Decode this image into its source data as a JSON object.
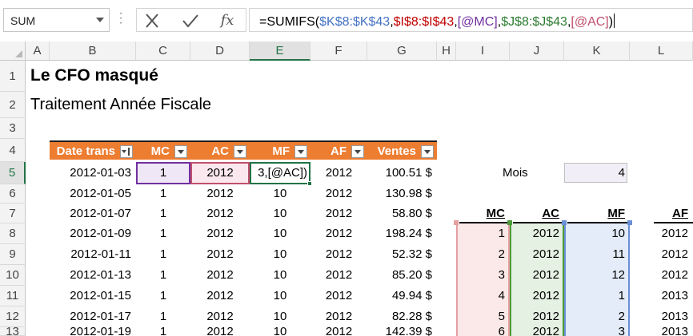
{
  "formula_bar": {
    "name_box": "SUM",
    "fx_label": "fx",
    "formula_parts": [
      {
        "text": "=SUMIFS(",
        "color": "#000000"
      },
      {
        "text": "$K$8:$K$43",
        "color": "#4472c4"
      },
      {
        "text": ",",
        "color": "#000000"
      },
      {
        "text": "$I$8:$I$43",
        "color": "#c00000"
      },
      {
        "text": ",",
        "color": "#000000"
      },
      {
        "text": "[@MC]",
        "color": "#7030a0"
      },
      {
        "text": ",",
        "color": "#000000"
      },
      {
        "text": "$J$8:$J$43",
        "color": "#2e7d32"
      },
      {
        "text": ",",
        "color": "#000000"
      },
      {
        "text": "[@AC]",
        "color": "#c0506e"
      },
      {
        "text": ")",
        "color": "#000000"
      }
    ]
  },
  "columns": [
    "A",
    "B",
    "C",
    "D",
    "E",
    "F",
    "G",
    "H",
    "I",
    "J",
    "K",
    "L"
  ],
  "rows": [
    "1",
    "2",
    "3",
    "4",
    "5",
    "6",
    "7",
    "8",
    "9",
    "10",
    "11",
    "12",
    "13"
  ],
  "selected_column": "E",
  "selected_row": "5",
  "sheet": {
    "title": "Le CFO masqué",
    "subtitle": "Traitement Année Fiscale",
    "table_headers": [
      "Date trans",
      "MC",
      "AC",
      "MF",
      "AF",
      "Ventes"
    ],
    "table_rows": [
      [
        "2012-01-03",
        "1",
        "2012",
        "3,[@AC])",
        "2012",
        "100.51 $"
      ],
      [
        "2012-01-05",
        "1",
        "2012",
        "10",
        "2012",
        "130.98 $"
      ],
      [
        "2012-01-07",
        "1",
        "2012",
        "10",
        "2012",
        "58.80 $"
      ],
      [
        "2012-01-09",
        "1",
        "2012",
        "10",
        "2012",
        "198.24 $"
      ],
      [
        "2012-01-11",
        "1",
        "2012",
        "10",
        "2012",
        "52.32 $"
      ],
      [
        "2012-01-13",
        "1",
        "2012",
        "10",
        "2012",
        "85.20 $"
      ],
      [
        "2012-01-15",
        "1",
        "2012",
        "10",
        "2012",
        "49.94 $"
      ],
      [
        "2012-01-17",
        "1",
        "2012",
        "10",
        "2012",
        "82.28 $"
      ],
      [
        "2012-01-19",
        "1",
        "2012",
        "10",
        "2012",
        "142.39 $"
      ]
    ],
    "mois_label": "Mois",
    "mois_value": "4",
    "lookup_headers": [
      "MC",
      "AC",
      "MF",
      "AF"
    ],
    "lookup_rows": [
      [
        "1",
        "2012",
        "10",
        "2012"
      ],
      [
        "2",
        "2012",
        "11",
        "2012"
      ],
      [
        "3",
        "2012",
        "12",
        "2012"
      ],
      [
        "4",
        "2012",
        "1",
        "2013"
      ],
      [
        "5",
        "2012",
        "2",
        "2013"
      ],
      [
        "6",
        "2012",
        "3",
        "2013"
      ]
    ]
  },
  "colors": {
    "table_header": "#ed7d31",
    "selection": "#217346",
    "ref_mc": "#7030a0",
    "ref_ac": "#c0506e",
    "range_k": "#4472c4",
    "range_i": "#c00000",
    "range_j": "#2e7d32"
  }
}
